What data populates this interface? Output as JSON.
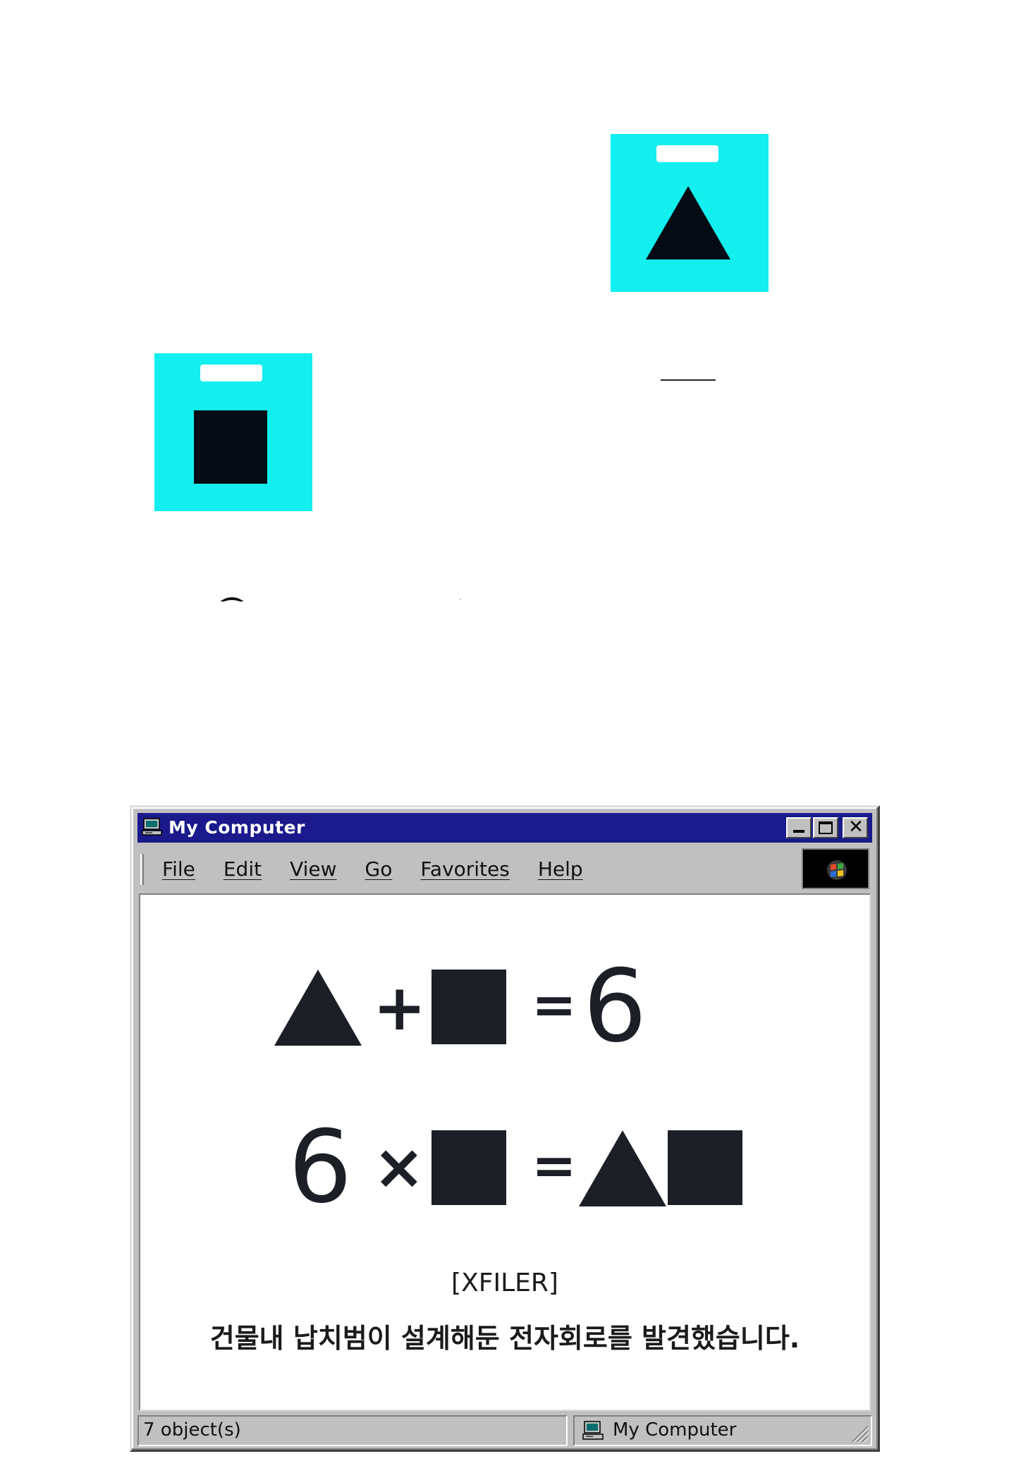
{
  "window": {
    "title": "My Computer",
    "controls": {
      "minimize": "minimize",
      "maximize": "maximize",
      "close": "✕"
    }
  },
  "menu": {
    "file": "File",
    "edit": "Edit",
    "view": "View",
    "go": "Go",
    "favorites": "Favorites",
    "help": "Help"
  },
  "puzzle": {
    "equation_1": {
      "plus": "+",
      "equals": "=",
      "result": "6"
    },
    "equation_2": {
      "lhs_number": "6",
      "times": "×",
      "equals": "="
    }
  },
  "caption": {
    "tag": "[XFILER]",
    "message": "건물내 납치범이 설계해둔 전자회로를 발견했습니다."
  },
  "status": {
    "objects": "7 object(s)",
    "location": "My Computer"
  },
  "icons": {
    "tile_triangle": "triangle-icon",
    "tile_square": "square-icon",
    "app": "computer-icon",
    "throbber": "windows-logo-icon",
    "status_location": "computer-icon"
  },
  "colors": {
    "tile": "#13eeee",
    "titlebar": "#1a1a8c",
    "shape": "#1c1f26",
    "chrome": "#c0c0c0"
  }
}
